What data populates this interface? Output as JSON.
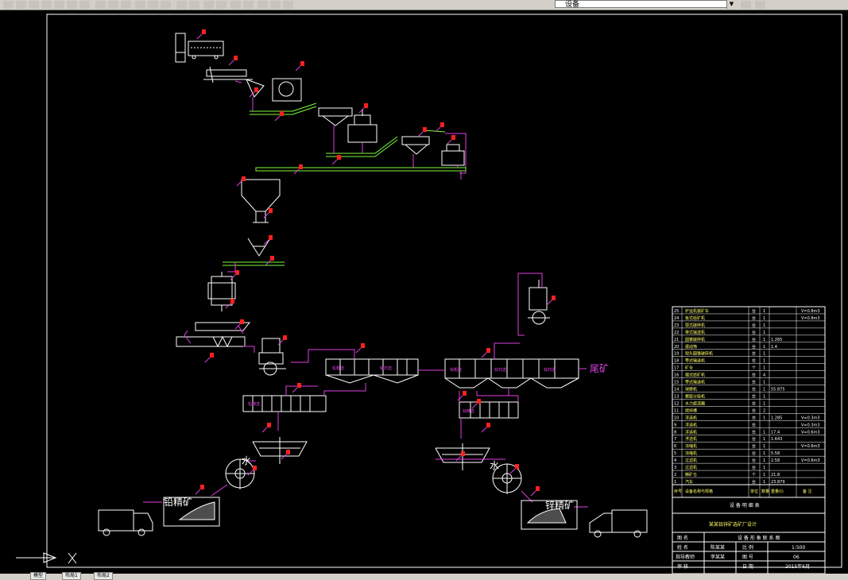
{
  "toolbar": {
    "layer_name": "设备",
    "icons": [
      "new-icon",
      "open-icon",
      "save-icon",
      "print-icon",
      "preview-icon",
      "cut-icon",
      "copy-icon",
      "paste-icon",
      "match-icon",
      "undo-icon",
      "redo-icon",
      "pan-icon",
      "zoom-realtime-icon",
      "zoom-window-icon",
      "zoom-previous-icon",
      "properties-icon",
      "design-center-icon",
      "tool-palette-icon",
      "sheet-set-icon",
      "markup-icon",
      "calc-icon",
      "help-icon",
      "layer-manager-icon",
      "layer-state-icon"
    ]
  },
  "tabs": [
    "模型",
    "布局1",
    "布局2"
  ],
  "drawing": {
    "labels": {
      "water_lead": "水",
      "water_zinc": "水",
      "lead_concentrate": "铅精矿",
      "zinc_concentrate": "锌精矿",
      "tailings": "尾矿"
    },
    "cell_texts": [
      "铅粗选",
      "铅扫选",
      "锌粗选",
      "锌扫选",
      "锌扫选",
      "铅精选",
      "锌精选"
    ]
  },
  "title_block": {
    "table_title": "设 备 明 细 表",
    "project": "某某铅锌矿选矿厂设计",
    "rows": [
      {
        "k": "图 名",
        "v": "设 备 形 象 联 系 图"
      },
      {
        "k": "姓 名",
        "v": "陈某某",
        "k2": "比 例",
        "v2": "1:500"
      },
      {
        "k": "指导教师",
        "v": "李某某",
        "k2": "图 号",
        "v2": "06"
      },
      {
        "k": "审 核",
        "v": "",
        "k2": "日 期",
        "v2": "2015年6月"
      }
    ],
    "header_cols": [
      "序号",
      "设备名称与规格",
      "单位",
      "数量",
      "重量(t)",
      "备 注"
    ],
    "equipment_rows": [
      {
        "n": "25",
        "name": "铲运机装矿车",
        "unit": "台",
        "qty": "1",
        "w": "",
        "note": "V=0.8m3"
      },
      {
        "n": "24",
        "name": "板式给矿机",
        "unit": "台",
        "qty": "1",
        "w": "",
        "note": "V=0.8m3"
      },
      {
        "n": "23",
        "name": "颚式破碎机",
        "unit": "台",
        "qty": "1",
        "w": "",
        "note": ""
      },
      {
        "n": "22",
        "name": "带式输送机",
        "unit": "台",
        "qty": "1",
        "w": "",
        "note": ""
      },
      {
        "n": "21",
        "name": "圆锥破碎机",
        "unit": "台",
        "qty": "1",
        "w": "1.265",
        "note": ""
      },
      {
        "n": "20",
        "name": "振动筛",
        "unit": "台",
        "qty": "1",
        "w": "1.4",
        "note": ""
      },
      {
        "n": "19",
        "name": "短头圆锥破碎机",
        "unit": "台",
        "qty": "1",
        "w": "",
        "note": ""
      },
      {
        "n": "18",
        "name": "带式输送机",
        "unit": "台",
        "qty": "1",
        "w": "",
        "note": ""
      },
      {
        "n": "17",
        "name": "矿仓",
        "unit": "个",
        "qty": "1",
        "w": "",
        "note": ""
      },
      {
        "n": "16",
        "name": "摆式给矿机",
        "unit": "台",
        "qty": "4",
        "w": "",
        "note": ""
      },
      {
        "n": "15",
        "name": "带式输送机",
        "unit": "台",
        "qty": "1",
        "w": "",
        "note": ""
      },
      {
        "n": "14",
        "name": "球磨机",
        "unit": "台",
        "qty": "1",
        "w": "55.875",
        "note": ""
      },
      {
        "n": "13",
        "name": "螺旋分级机",
        "unit": "台",
        "qty": "1",
        "w": "",
        "note": ""
      },
      {
        "n": "12",
        "name": "水力旋流器",
        "unit": "台",
        "qty": "1",
        "w": "",
        "note": ""
      },
      {
        "n": "11",
        "name": "搅拌槽",
        "unit": "台",
        "qty": "2",
        "w": "",
        "note": ""
      },
      {
        "n": "10",
        "name": "浮选机",
        "unit": "台",
        "qty": "1",
        "w": "1.285",
        "note": "V=0.3m3"
      },
      {
        "n": "9",
        "name": "浮选机",
        "unit": "台",
        "qty": "",
        "w": "",
        "note": "V=0.3m3"
      },
      {
        "n": "8",
        "name": "浮选机",
        "unit": "台",
        "qty": "1",
        "w": "17.4",
        "note": "V=0.6m3"
      },
      {
        "n": "7",
        "name": "浮选机",
        "unit": "台",
        "qty": "1",
        "w": "1.643",
        "note": ""
      },
      {
        "n": "6",
        "name": "浓缩机",
        "unit": "台",
        "qty": "1",
        "w": "",
        "note": "V=0.6m3"
      },
      {
        "n": "5",
        "name": "浓缩机",
        "unit": "台",
        "qty": "1",
        "w": "5.58",
        "note": ""
      },
      {
        "n": "4",
        "name": "过滤机",
        "unit": "台",
        "qty": "1",
        "w": "2.58",
        "note": "V=0.6m3"
      },
      {
        "n": "3",
        "name": "过滤机",
        "unit": "台",
        "qty": "1",
        "w": "",
        "note": ""
      },
      {
        "n": "2",
        "name": "精矿仓",
        "unit": "个",
        "qty": "1",
        "w": "21.8",
        "note": ""
      },
      {
        "n": "1",
        "name": "汽车",
        "unit": "台",
        "qty": "1",
        "w": "23.879",
        "note": ""
      }
    ]
  }
}
